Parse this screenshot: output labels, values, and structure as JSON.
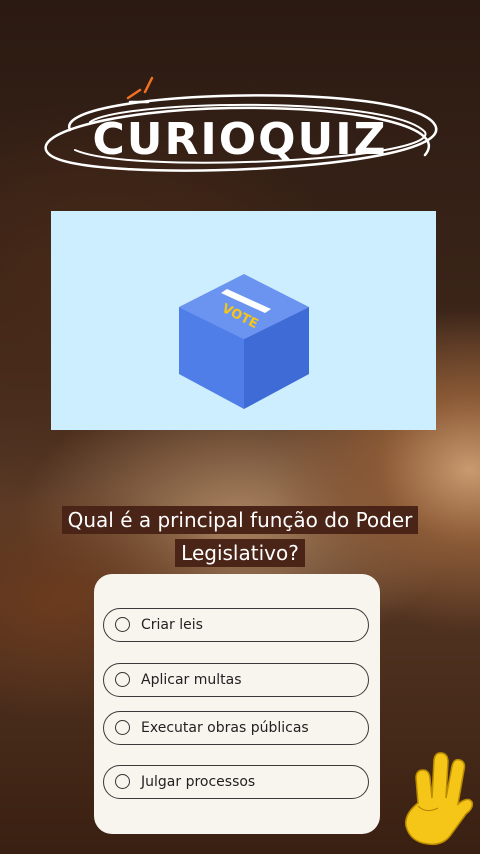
{
  "header": {
    "title": "CURIOQUIZ"
  },
  "image": {
    "box_label": "VOTE"
  },
  "question": {
    "text": "Qual é a principal função do Poder Legislativo?"
  },
  "options": [
    {
      "label": "Criar leis"
    },
    {
      "label": "Aplicar multas"
    },
    {
      "label": "Executar obras públicas"
    },
    {
      "label": "Julgar processos"
    }
  ],
  "colors": {
    "accent": "#f37021",
    "image_bg": "#cdeefe",
    "ballot_box": "#4f7ee8",
    "question_bg": "#4a2416",
    "card_bg": "#f8f5ef",
    "hand": "#f5c518"
  },
  "icons": {
    "ballot": "ballot-box-icon",
    "hand": "hand-three-fingers-icon"
  }
}
